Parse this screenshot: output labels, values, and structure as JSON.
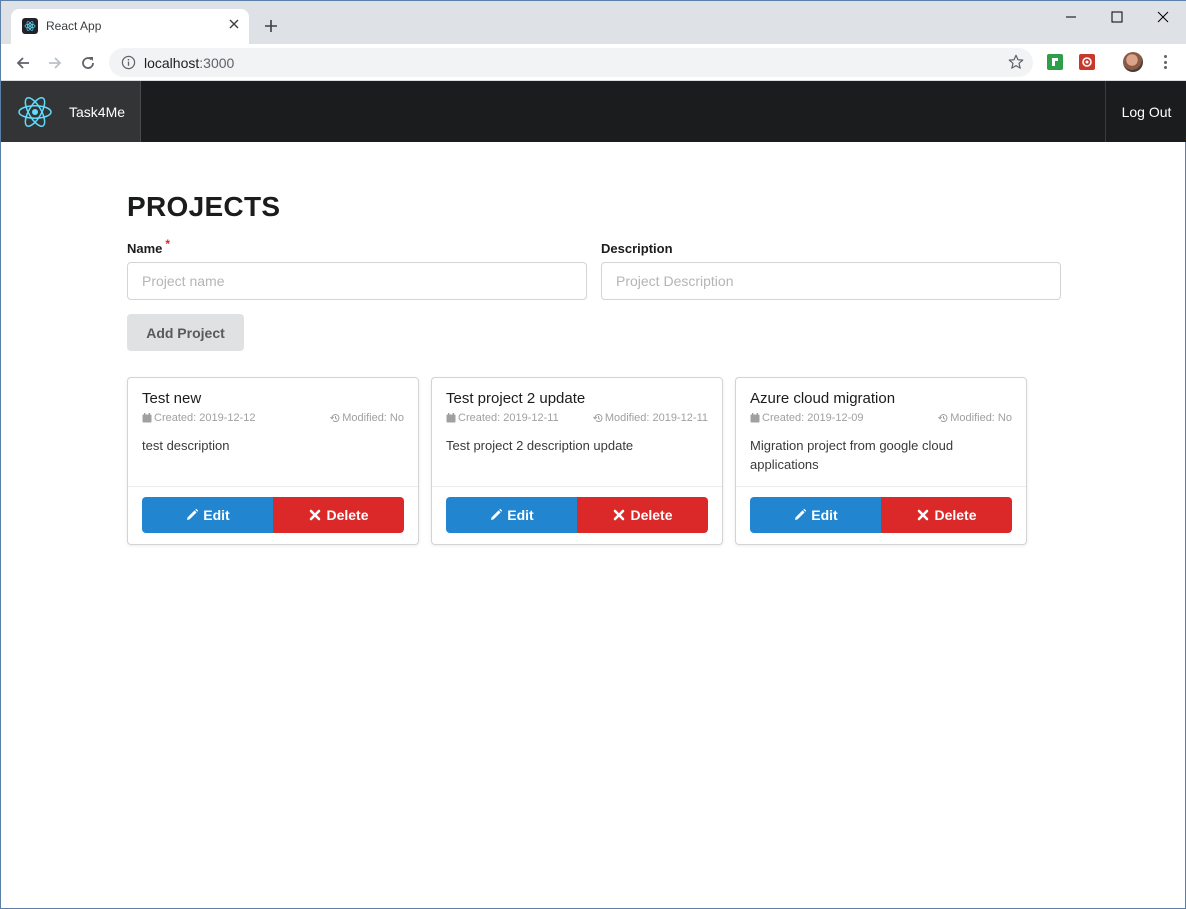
{
  "browser": {
    "tab_title": "React App",
    "url_host": "localhost",
    "url_port": ":3000"
  },
  "navbar": {
    "brand": "Task4Me",
    "logout": "Log Out"
  },
  "page": {
    "title": "PROJECTS",
    "name_label": "Name",
    "name_required_marker": "*",
    "name_placeholder": "Project name",
    "description_label": "Description",
    "description_placeholder": "Project Description",
    "add_button": "Add Project"
  },
  "projects": [
    {
      "name": "Test new",
      "created": "Created: 2019-12-12",
      "modified": "Modified: No",
      "description": "test description",
      "edit": "Edit",
      "delete": "Delete"
    },
    {
      "name": "Test project 2 update",
      "created": "Created: 2019-12-11",
      "modified": "Modified: 2019-12-11",
      "description": "Test project 2 description update",
      "edit": "Edit",
      "delete": "Delete"
    },
    {
      "name": "Azure cloud migration",
      "created": "Created: 2019-12-09",
      "modified": "Modified: No",
      "description": "Migration project from google cloud applications",
      "edit": "Edit",
      "delete": "Delete"
    }
  ],
  "colors": {
    "navbar": "#1b1c1d",
    "edit_button": "#2185d0",
    "delete_button": "#db2828"
  }
}
